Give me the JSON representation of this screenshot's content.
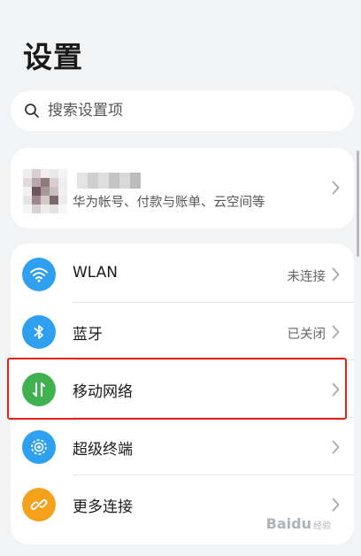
{
  "page": {
    "title": "设置"
  },
  "search": {
    "placeholder": "搜索设置项"
  },
  "account": {
    "description": "华为帐号、付款与账单、云空间等"
  },
  "settings": {
    "items": [
      {
        "label": "WLAN",
        "status": "未连接",
        "icon": "wifi-icon",
        "color": "#2f9ff0"
      },
      {
        "label": "蓝牙",
        "status": "已关闭",
        "icon": "bluetooth-icon",
        "color": "#2f9ff0"
      },
      {
        "label": "移动网络",
        "status": "",
        "icon": "mobile-data-icon",
        "color": "#3fb14f"
      },
      {
        "label": "超级终端",
        "status": "",
        "icon": "super-device-icon",
        "color": "#2f9ff0"
      },
      {
        "label": "更多连接",
        "status": "",
        "icon": "link-icon",
        "color": "#f5a11c"
      }
    ]
  },
  "colors": {
    "highlight": "#e2231a",
    "background": "#f1f3f5"
  },
  "watermark": {
    "brand": "Baidu",
    "sub": "经验"
  }
}
